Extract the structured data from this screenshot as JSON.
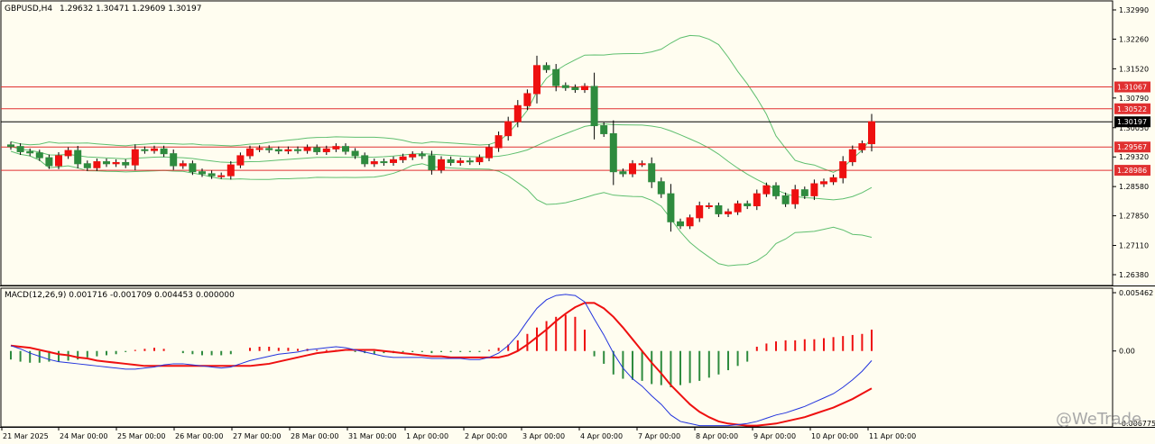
{
  "header": {
    "symbol": "GBPUSD,H4",
    "ohlc": "1.29632 1.30471 1.29609 1.30197"
  },
  "macd_header": "MACD(12,26,9) 0.001716 -0.001709 0.004453 0.000000",
  "watermark": "@WeTrade",
  "colors": {
    "background": "#fffdf0",
    "bull": "#2e8b3e",
    "bear": "#ee1010",
    "band": "#5fbf6f",
    "level": "#e03030",
    "macd_signal": "#ee1010",
    "macd_line": "#2233dd"
  },
  "chart_data": [
    {
      "type": "candlestick",
      "title": "GBPUSD,H4",
      "y_ticks": [
        "1.32990",
        "1.32260",
        "1.31520",
        "1.30790",
        "1.30050",
        "1.29320",
        "1.28580",
        "1.27850",
        "1.27110",
        "1.26380"
      ],
      "ylim": [
        1.2608,
        1.3328
      ],
      "x_labels": [
        "21 Mar 2025",
        "24 Mar 00:00",
        "25 Mar 00:00",
        "26 Mar 00:00",
        "27 Mar 00:00",
        "28 Mar 00:00",
        "31 Mar 00:00",
        "1 Apr 00:00",
        "2 Apr 00:00",
        "3 Apr 00:00",
        "4 Apr 00:00",
        "7 Apr 00:00",
        "8 Apr 00:00",
        "9 Apr 00:00",
        "10 Apr 00:00",
        "11 Apr 00:00"
      ],
      "levels": [
        {
          "value": 1.31067,
          "label": "1.31067"
        },
        {
          "value": 1.30522,
          "label": "1.30522"
        },
        {
          "value": 1.29567,
          "label": "1.29567"
        },
        {
          "value": 1.28986,
          "label": "1.28986"
        }
      ],
      "current_price": {
        "value": 1.30197,
        "label": "1.30197"
      },
      "candles_close": [
        1.2958,
        1.2945,
        1.2942,
        1.293,
        1.291,
        1.2935,
        1.2948,
        1.2915,
        1.2905,
        1.292,
        1.2915,
        1.2918,
        1.2912,
        1.295,
        1.2948,
        1.2952,
        1.294,
        1.291,
        1.2915,
        1.2895,
        1.289,
        1.2885,
        1.2885,
        1.2912,
        1.2935,
        1.2952,
        1.2953,
        1.295,
        1.2947,
        1.295,
        1.2948,
        1.2955,
        1.2945,
        1.2952,
        1.2958,
        1.2946,
        1.2935,
        1.2915,
        1.292,
        1.2918,
        1.2925,
        1.2932,
        1.2938,
        1.2935,
        1.29,
        1.2925,
        1.2918,
        1.2922,
        1.292,
        1.293,
        1.2955,
        1.2985,
        1.302,
        1.306,
        1.309,
        1.316,
        1.315,
        1.311,
        1.3105,
        1.31,
        1.3108,
        1.301,
        1.299,
        1.2895,
        1.289,
        1.2915,
        1.2915,
        1.287,
        1.284,
        1.277,
        1.276,
        1.278,
        1.281,
        1.281,
        1.279,
        1.2795,
        1.2815,
        1.281,
        1.284,
        1.286,
        1.2835,
        1.2815,
        1.285,
        1.2835,
        1.2865,
        1.287,
        1.288,
        1.292,
        1.295,
        1.2965,
        1.302
      ],
      "bollinger": "upper, middle and lower bands drawn"
    },
    {
      "type": "line",
      "title": "MACD(12,26,9) 0.001716 -0.001709 0.004453 0.000000",
      "y_ticks": [
        "0.005462",
        "0.00",
        "-0.006775"
      ],
      "ylim": [
        -0.006775,
        0.005462
      ],
      "histogram": [
        -0.0008,
        -0.001,
        -0.0011,
        -0.0011,
        -0.001,
        -0.001,
        -0.0009,
        -0.0008,
        -0.0006,
        -0.0005,
        -0.0004,
        -0.0003,
        -0.0001,
        0.0001,
        0.0002,
        0.0003,
        0.0002,
        0.0,
        -0.0002,
        -0.0003,
        -0.0004,
        -0.0004,
        -0.0004,
        -0.0003,
        0.0,
        0.0003,
        0.0004,
        0.0004,
        0.0003,
        0.0003,
        0.0002,
        0.0002,
        0.0001,
        0.0001,
        0.0001,
        0.0,
        -0.0001,
        -0.0002,
        -0.0003,
        -0.0002,
        -0.0002,
        -0.0001,
        -0.0001,
        -0.0001,
        -0.0002,
        -0.0001,
        -0.0001,
        -0.0001,
        -0.0001,
        -0.0001,
        0.0001,
        0.0003,
        0.0006,
        0.001,
        0.0016,
        0.0022,
        0.0028,
        0.0032,
        0.0034,
        0.0032,
        0.002,
        -0.0005,
        -0.0012,
        -0.0022,
        -0.0026,
        -0.0027,
        -0.0028,
        -0.0031,
        -0.0032,
        -0.0034,
        -0.0032,
        -0.003,
        -0.0028,
        -0.0025,
        -0.0022,
        -0.0018,
        -0.0014,
        -0.001,
        0.0004,
        0.0007,
        0.0009,
        0.001,
        0.001,
        0.0011,
        0.0011,
        0.0012,
        0.0013,
        0.0014,
        0.0015,
        0.0016,
        0.002
      ],
      "macd_line": [
        0.0005,
        0.0002,
        -0.0002,
        -0.0005,
        -0.0008,
        -0.001,
        -0.0011,
        -0.0012,
        -0.0013,
        -0.0014,
        -0.0015,
        -0.0016,
        -0.0017,
        -0.0017,
        -0.0016,
        -0.0015,
        -0.0013,
        -0.0012,
        -0.0012,
        -0.0013,
        -0.0014,
        -0.0015,
        -0.0016,
        -0.0015,
        -0.0012,
        -0.0009,
        -0.0007,
        -0.0005,
        -0.0003,
        -0.0002,
        -0.0001,
        0.0001,
        0.0002,
        0.0003,
        0.0004,
        0.0003,
        0.0001,
        -0.0001,
        -0.0003,
        -0.0005,
        -0.0006,
        -0.0006,
        -0.0006,
        -0.0006,
        -0.0007,
        -0.0007,
        -0.0007,
        -0.0007,
        -0.0008,
        -0.0008,
        -0.0006,
        -0.0002,
        0.0005,
        0.0015,
        0.0028,
        0.004,
        0.0048,
        0.0052,
        0.0053,
        0.0052,
        0.0046,
        0.003,
        0.0015,
        -0.0002,
        -0.0016,
        -0.0026,
        -0.0033,
        -0.0042,
        -0.005,
        -0.006,
        -0.0066,
        -0.0068,
        -0.007,
        -0.007,
        -0.007,
        -0.007,
        -0.0069,
        -0.0068,
        -0.0066,
        -0.0063,
        -0.006,
        -0.0058,
        -0.0055,
        -0.0052,
        -0.0048,
        -0.0044,
        -0.004,
        -0.0034,
        -0.0027,
        -0.0019,
        -0.0009
      ],
      "signal_line": [
        0.0005,
        0.0004,
        0.0003,
        0.0001,
        -0.0001,
        -0.0003,
        -0.0004,
        -0.0006,
        -0.0007,
        -0.0009,
        -0.001,
        -0.0011,
        -0.0012,
        -0.0013,
        -0.0014,
        -0.0014,
        -0.0014,
        -0.0014,
        -0.0014,
        -0.0014,
        -0.0014,
        -0.0014,
        -0.0014,
        -0.0014,
        -0.0014,
        -0.0014,
        -0.0013,
        -0.0012,
        -0.001,
        -0.0008,
        -0.0006,
        -0.0004,
        -0.0002,
        -0.0001,
        0.0,
        0.0001,
        0.0001,
        0.0001,
        0.0001,
        0.0,
        -0.0001,
        -0.0002,
        -0.0003,
        -0.0004,
        -0.0005,
        -0.0005,
        -0.0006,
        -0.0006,
        -0.0006,
        -0.0006,
        -0.0006,
        -0.0006,
        -0.0004,
        0.0,
        0.0006,
        0.0013,
        0.002,
        0.0028,
        0.0035,
        0.0041,
        0.0045,
        0.0045,
        0.004,
        0.0032,
        0.0022,
        0.0011,
        0.0,
        -0.0011,
        -0.0021,
        -0.0032,
        -0.0041,
        -0.005,
        -0.0057,
        -0.0062,
        -0.0066,
        -0.0068,
        -0.0069,
        -0.007,
        -0.007,
        -0.0069,
        -0.0068,
        -0.0066,
        -0.0064,
        -0.0062,
        -0.0059,
        -0.0056,
        -0.0053,
        -0.0049,
        -0.0045,
        -0.004,
        -0.0035
      ]
    }
  ]
}
